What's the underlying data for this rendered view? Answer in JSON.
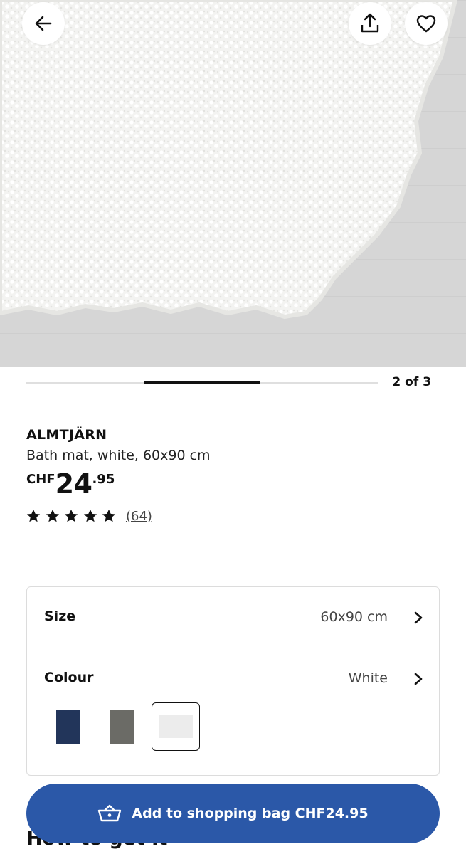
{
  "header": {
    "back_icon": "arrow-left-icon",
    "share_icon": "share-upload-icon",
    "favourite_icon": "heart-outline-icon"
  },
  "gallery": {
    "counter": "2 of 3",
    "current_image": 2,
    "total_images": 3
  },
  "product": {
    "name": "ALMTJÄRN",
    "description": "Bath mat, white, 60x90 cm",
    "price": {
      "currency": "CHF",
      "integer": "24",
      "decimal": ".95"
    },
    "rating": {
      "stars": 5,
      "max_stars": 5,
      "review_count": "(64)"
    }
  },
  "options": {
    "size": {
      "label": "Size",
      "value": "60x90 cm"
    },
    "colour": {
      "label": "Colour",
      "value": "White",
      "swatches": [
        {
          "name": "dark-blue",
          "color": "#22355a",
          "selected": false
        },
        {
          "name": "grey",
          "color": "#6b6b66",
          "selected": false
        },
        {
          "name": "white",
          "color": "#ececec",
          "selected": true
        }
      ]
    }
  },
  "cta": {
    "label": "Add to shopping bag CHF24.95",
    "icon": "shopping-basket-icon",
    "color": "#2b58a8"
  },
  "next_section": {
    "title": "How to get it"
  }
}
